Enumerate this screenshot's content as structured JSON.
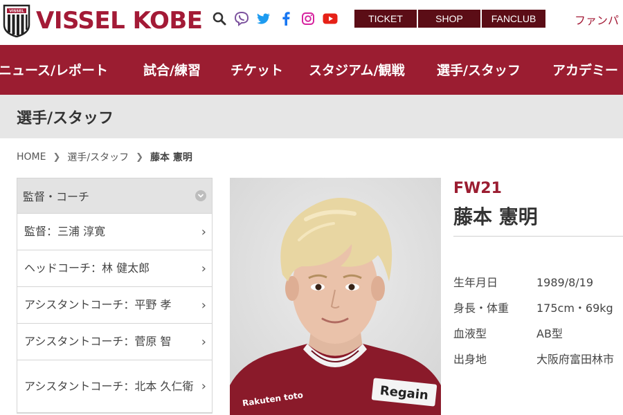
{
  "header": {
    "logo_text": "VISSEL KOBE",
    "logo_crest_text": "VISSEL",
    "icons": [
      "search-icon",
      "viber-icon",
      "twitter-icon",
      "facebook-icon",
      "instagram-icon",
      "youtube-icon"
    ],
    "pills": [
      "TICKET",
      "SHOP",
      "FANCLUB"
    ],
    "fan_link": "ファンパ"
  },
  "nav": {
    "items": [
      "ニュース/レポート",
      "試合/練習",
      "チケット",
      "スタジアム/観戦",
      "選手/スタッフ",
      "アカデミー"
    ]
  },
  "page": {
    "title": "選手/スタッフ"
  },
  "breadcrumb": {
    "home": "HOME",
    "section": "選手/スタッフ",
    "current": "藤本 憲明"
  },
  "sidebar": {
    "heading": "監督・コーチ",
    "items": [
      {
        "label": "監督：三浦 淳寛"
      },
      {
        "label": "ヘッドコーチ：林 健太郎"
      },
      {
        "label": "アシスタントコーチ：平野 孝"
      },
      {
        "label": "アシスタントコーチ：菅原 智"
      },
      {
        "label": "アシスタントコーチ：北本 久仁衛"
      }
    ]
  },
  "player": {
    "position": "FW21",
    "name": "藤本 憲明",
    "shirt_sponsor": "Regain",
    "shirt_brand": "Rakuten toto",
    "profile": [
      {
        "label": "生年月日",
        "value": "1989/8/19"
      },
      {
        "label": "身長・体重",
        "value": "175cm・69kg"
      },
      {
        "label": "血液型",
        "value": "AB型"
      },
      {
        "label": "出身地",
        "value": "大阪府富田林市"
      }
    ]
  },
  "colors": {
    "brand": "#9b1d31",
    "pill_bg": "#5b0d16",
    "title_band": "#e6e6e6"
  }
}
